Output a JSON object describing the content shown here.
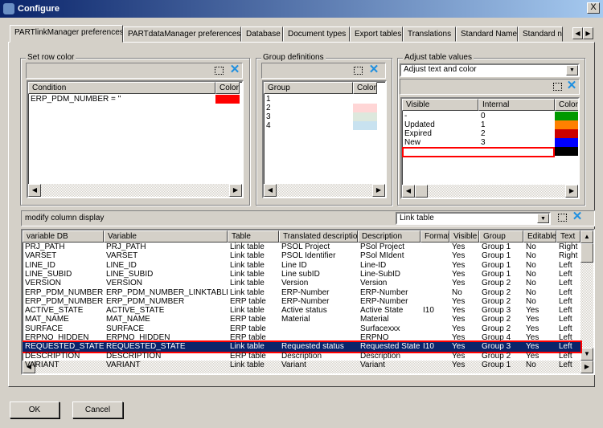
{
  "window": {
    "title": "Configure",
    "close": "X"
  },
  "tabs": [
    "PARTlinkManager preferences",
    "PARTdataManager preferences",
    "Database",
    "Document types",
    "Export tables",
    "Translations",
    "Standard Name",
    "Standard n"
  ],
  "row_color": {
    "title": "Set row color",
    "headers": [
      "Condition",
      "Color"
    ],
    "rows": [
      {
        "condition": "ERP_PDM_NUMBER = ''",
        "color": "#ff0000"
      }
    ]
  },
  "groups": {
    "title": "Group definitions",
    "headers": [
      "Group",
      "Color"
    ],
    "rows": [
      {
        "group": "1",
        "color": "#ffffff"
      },
      {
        "group": "2",
        "color": "#ffd6d6"
      },
      {
        "group": "3",
        "color": "#dde8dd"
      },
      {
        "group": "4",
        "color": "#c8e2f0"
      }
    ]
  },
  "adjust": {
    "title": "Adjust table values",
    "mode": "Adjust text and color",
    "headers": [
      "Visible",
      "Internal",
      "Color"
    ],
    "rows": [
      {
        "visible": "-",
        "internal": "0",
        "color": "#009900"
      },
      {
        "visible": "Updated",
        "internal": "1",
        "color": "#ff8000"
      },
      {
        "visible": "Expired",
        "internal": "2",
        "color": "#cc0000"
      },
      {
        "visible": "New",
        "internal": "3",
        "color": "#0000ff"
      },
      {
        "visible": "",
        "internal": "",
        "color": "#000000"
      }
    ]
  },
  "columns": {
    "title": "modify column display",
    "table_select": "Link table",
    "headers": [
      "variable DB",
      "Variable",
      "Table",
      "Translated description",
      "Description",
      "Format",
      "Visible",
      "Group",
      "Editable",
      "Text"
    ],
    "rows": [
      [
        "PRJ_PATH",
        "PRJ_PATH",
        "Link table",
        "PSOL Project",
        "PSol Project",
        "",
        "Yes",
        "Group 1",
        "No",
        "Right"
      ],
      [
        "VARSET",
        "VARSET",
        "Link table",
        "PSOL Identifier",
        "PSol MIdent",
        "",
        "Yes",
        "Group 1",
        "No",
        "Right"
      ],
      [
        "LINE_ID",
        "LINE_ID",
        "Link table",
        "Line ID",
        "Line-ID",
        "",
        "Yes",
        "Group 1",
        "No",
        "Left"
      ],
      [
        "LINE_SUBID",
        "LINE_SUBID",
        "Link table",
        "Line subID",
        "Line-SubID",
        "",
        "Yes",
        "Group 1",
        "No",
        "Left"
      ],
      [
        "VERSION",
        "VERSION",
        "Link table",
        "Version",
        "Version",
        "",
        "Yes",
        "Group 2",
        "No",
        "Left"
      ],
      [
        "ERP_PDM_NUMBER",
        "ERP_PDM_NUMBER_LINKTABLE",
        "Link table",
        "ERP-Number",
        "ERP-Number",
        "",
        "No",
        "Group 2",
        "No",
        "Left"
      ],
      [
        "ERP_PDM_NUMBER",
        "ERP_PDM_NUMBER",
        "ERP table",
        "ERP-Number",
        "ERP-Number",
        "",
        "Yes",
        "Group 2",
        "No",
        "Left"
      ],
      [
        "ACTIVE_STATE",
        "ACTIVE_STATE",
        "Link table",
        "Active status",
        "Active State",
        "I10",
        "Yes",
        "Group 3",
        "Yes",
        "Left"
      ],
      [
        "MAT_NAME",
        "MAT_NAME",
        "ERP table",
        "Material",
        "Material",
        "",
        "Yes",
        "Group 2",
        "Yes",
        "Left"
      ],
      [
        "SURFACE",
        "SURFACE",
        "ERP table",
        "",
        "Surfacexxx",
        "",
        "Yes",
        "Group 2",
        "Yes",
        "Left"
      ],
      [
        "ERPNO_HIDDEN",
        "ERPNO_HIDDEN",
        "ERP table",
        "",
        "ERPNO",
        "",
        "Yes",
        "Group 4",
        "Yes",
        "Left"
      ],
      [
        "REQUESTED_STATE",
        "REQUESTED_STATE",
        "Link table",
        "Requested status",
        "Requested State",
        "I10",
        "Yes",
        "Group 3",
        "Yes",
        "Left"
      ],
      [
        "DESCRIPTION",
        "DESCRIPTION",
        "ERP table",
        "Description",
        "Description",
        "",
        "Yes",
        "Group 2",
        "Yes",
        "Left"
      ],
      [
        "VARIANT",
        "VARIANT",
        "Link table",
        "Variant",
        "Variant",
        "",
        "Yes",
        "Group 1",
        "No",
        "Left"
      ]
    ],
    "selected_index": 11
  },
  "buttons": {
    "ok": "OK",
    "cancel": "Cancel"
  }
}
